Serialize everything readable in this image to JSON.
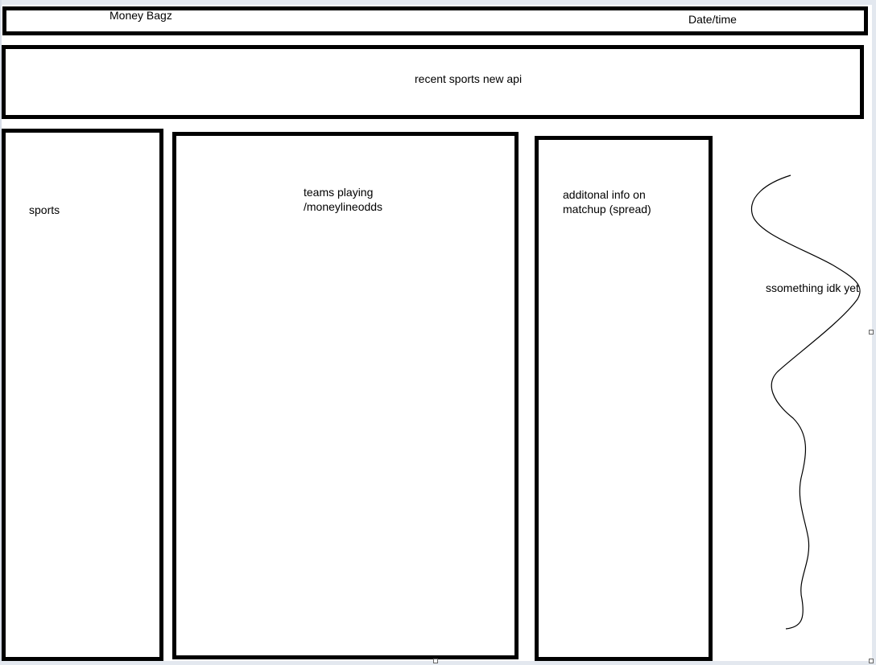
{
  "header": {
    "title": "Money Bagz",
    "datetime": "Date/time"
  },
  "news": {
    "label": "recent sports new api"
  },
  "sports_panel": {
    "label": "sports"
  },
  "teams_panel": {
    "label": "teams playing\n/moneylineodds"
  },
  "info_panel": {
    "label": "additonal info on\nmatchup (spread)"
  },
  "extra": {
    "label": "ssomething idk yet"
  }
}
